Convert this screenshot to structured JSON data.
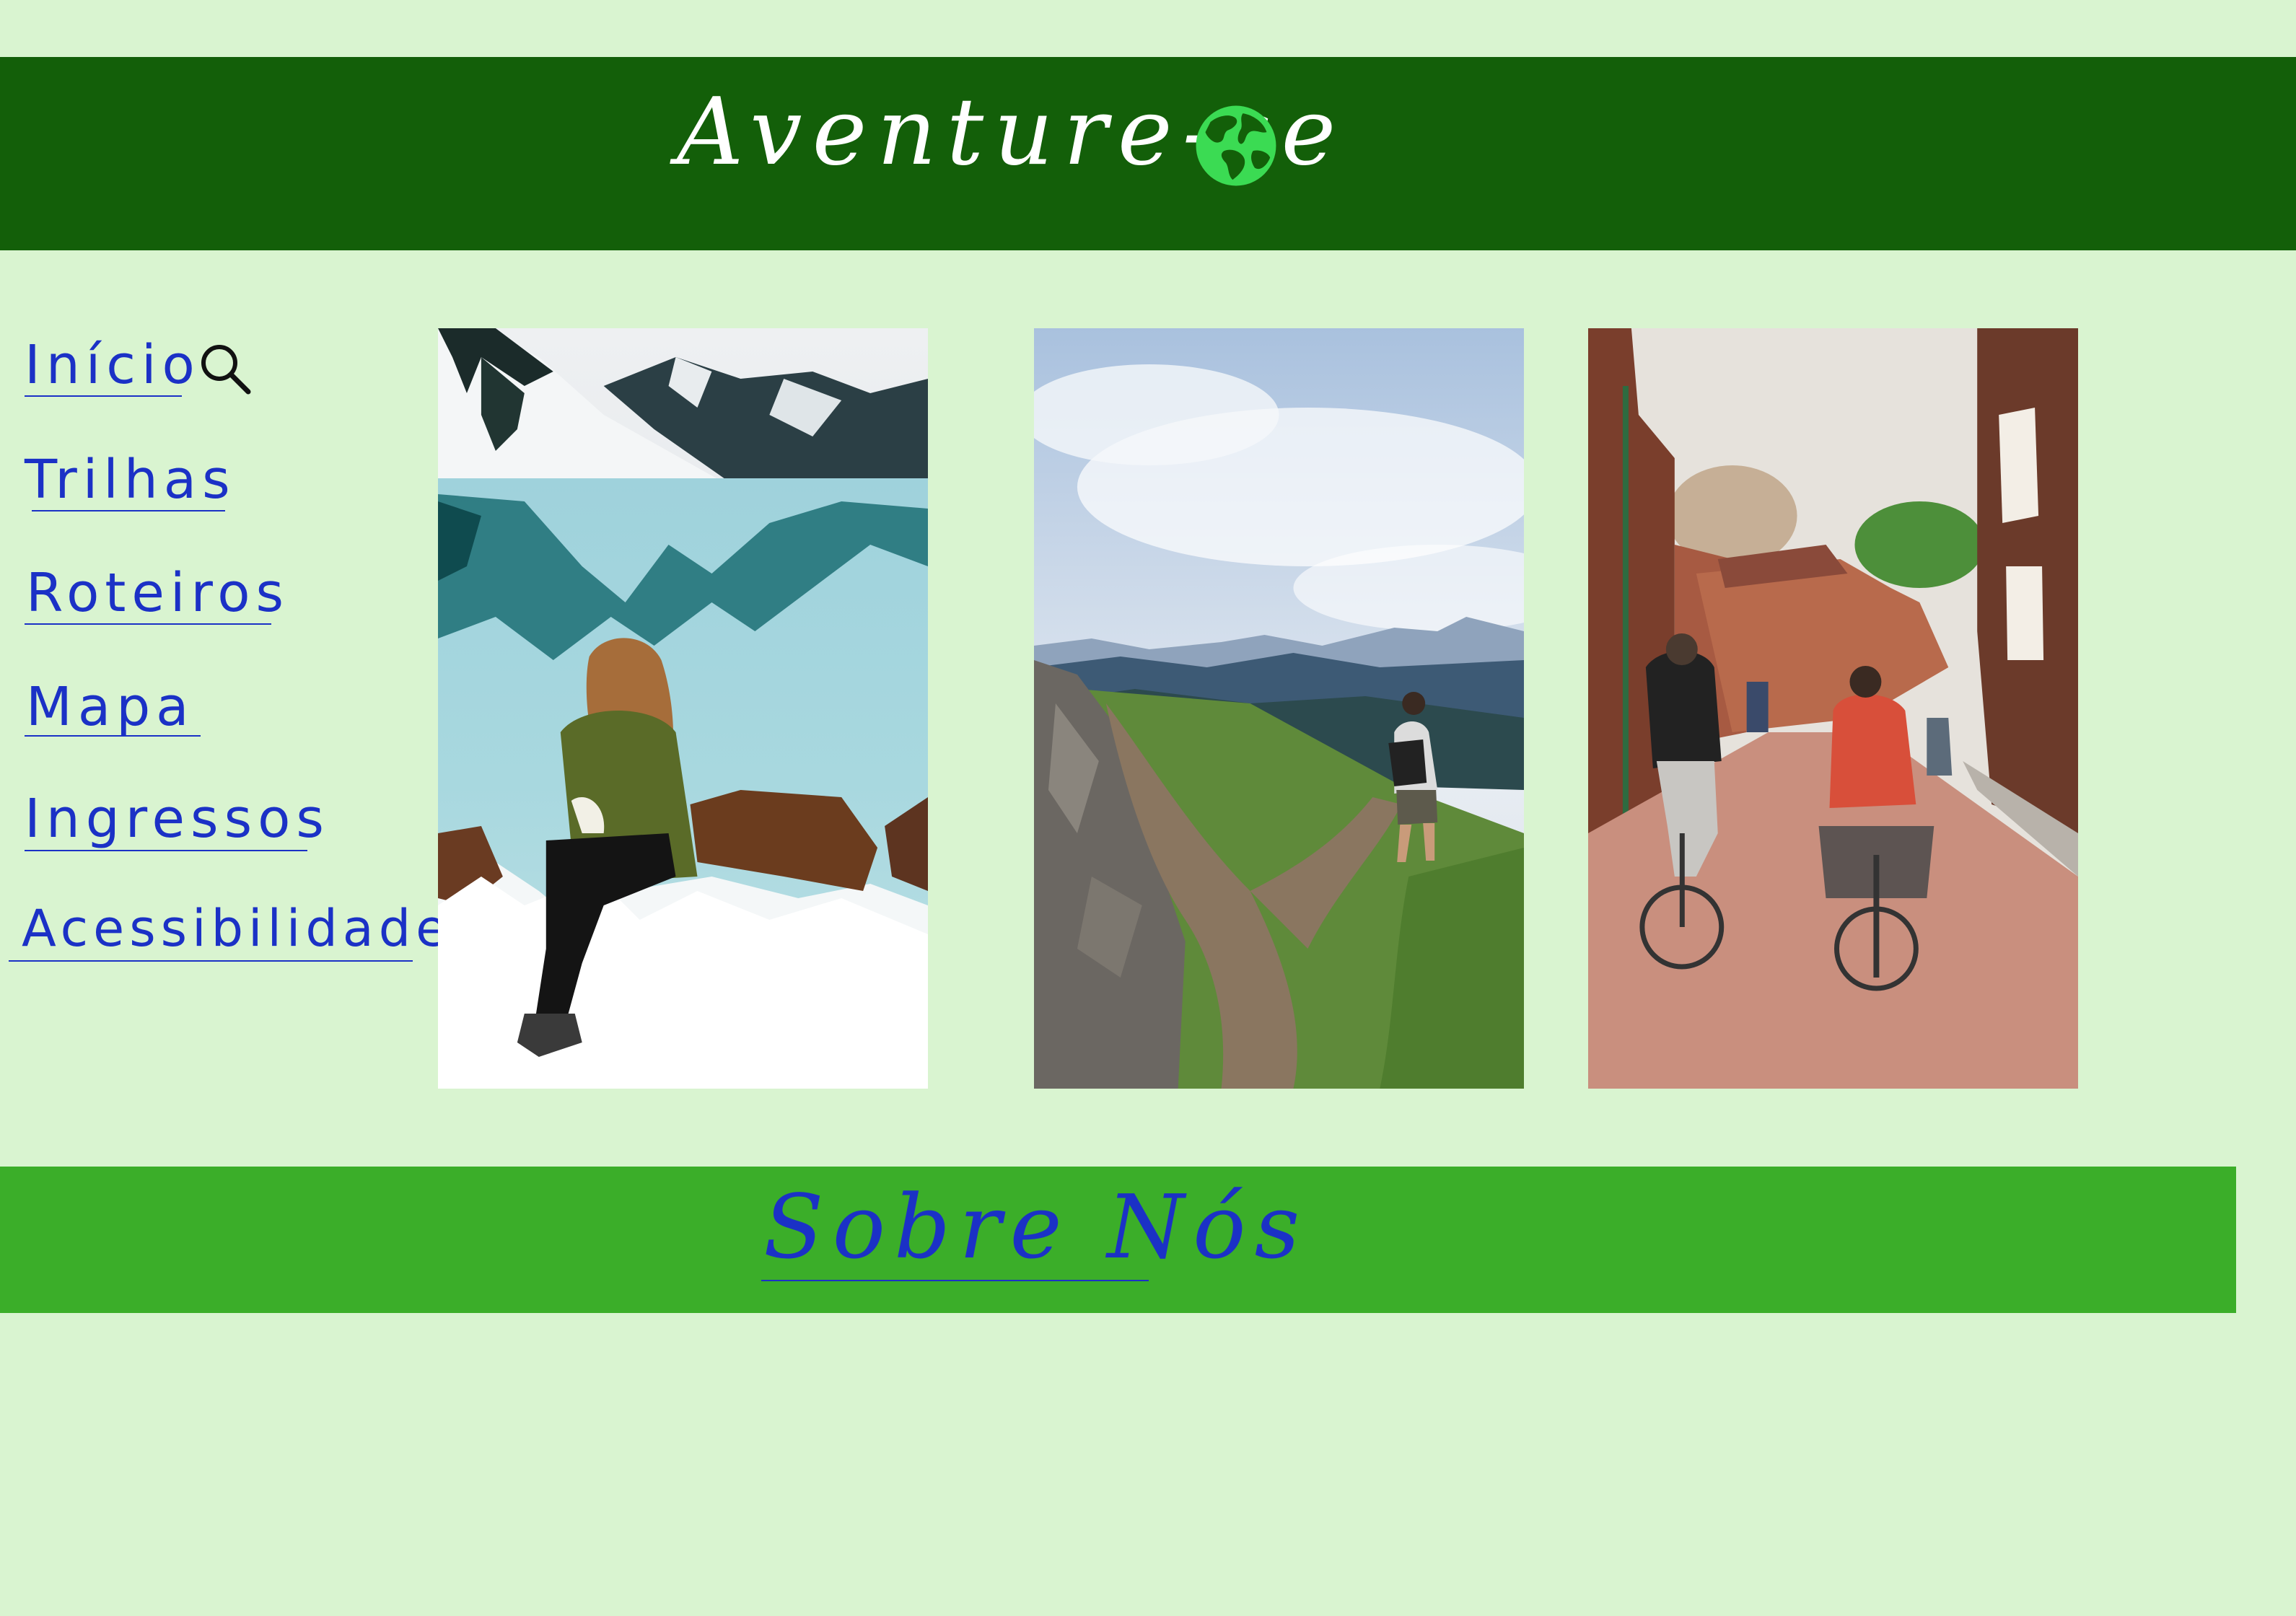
{
  "header": {
    "title": "Aventure-se",
    "globe_icon": "globe-icon",
    "background": "#135f09",
    "accent": "#3bdb53"
  },
  "nav": {
    "items": [
      {
        "label": "Início"
      },
      {
        "label": "Trilhas"
      },
      {
        "label": "Roteiros"
      },
      {
        "label": "Mapa"
      },
      {
        "label": "Ingressos"
      },
      {
        "label": "Acessibilidade"
      }
    ],
    "search_icon": "search-icon",
    "link_color": "#1b31c6"
  },
  "gallery": {
    "images": [
      {
        "subject": "woman-by-frozen-lake"
      },
      {
        "subject": "hiker-on-mountain-trail"
      },
      {
        "subject": "cyclists-on-town-street"
      }
    ]
  },
  "footer": {
    "link": "Sobre Nós",
    "background": "#3bae29"
  },
  "page": {
    "background": "#d9f4d0"
  }
}
